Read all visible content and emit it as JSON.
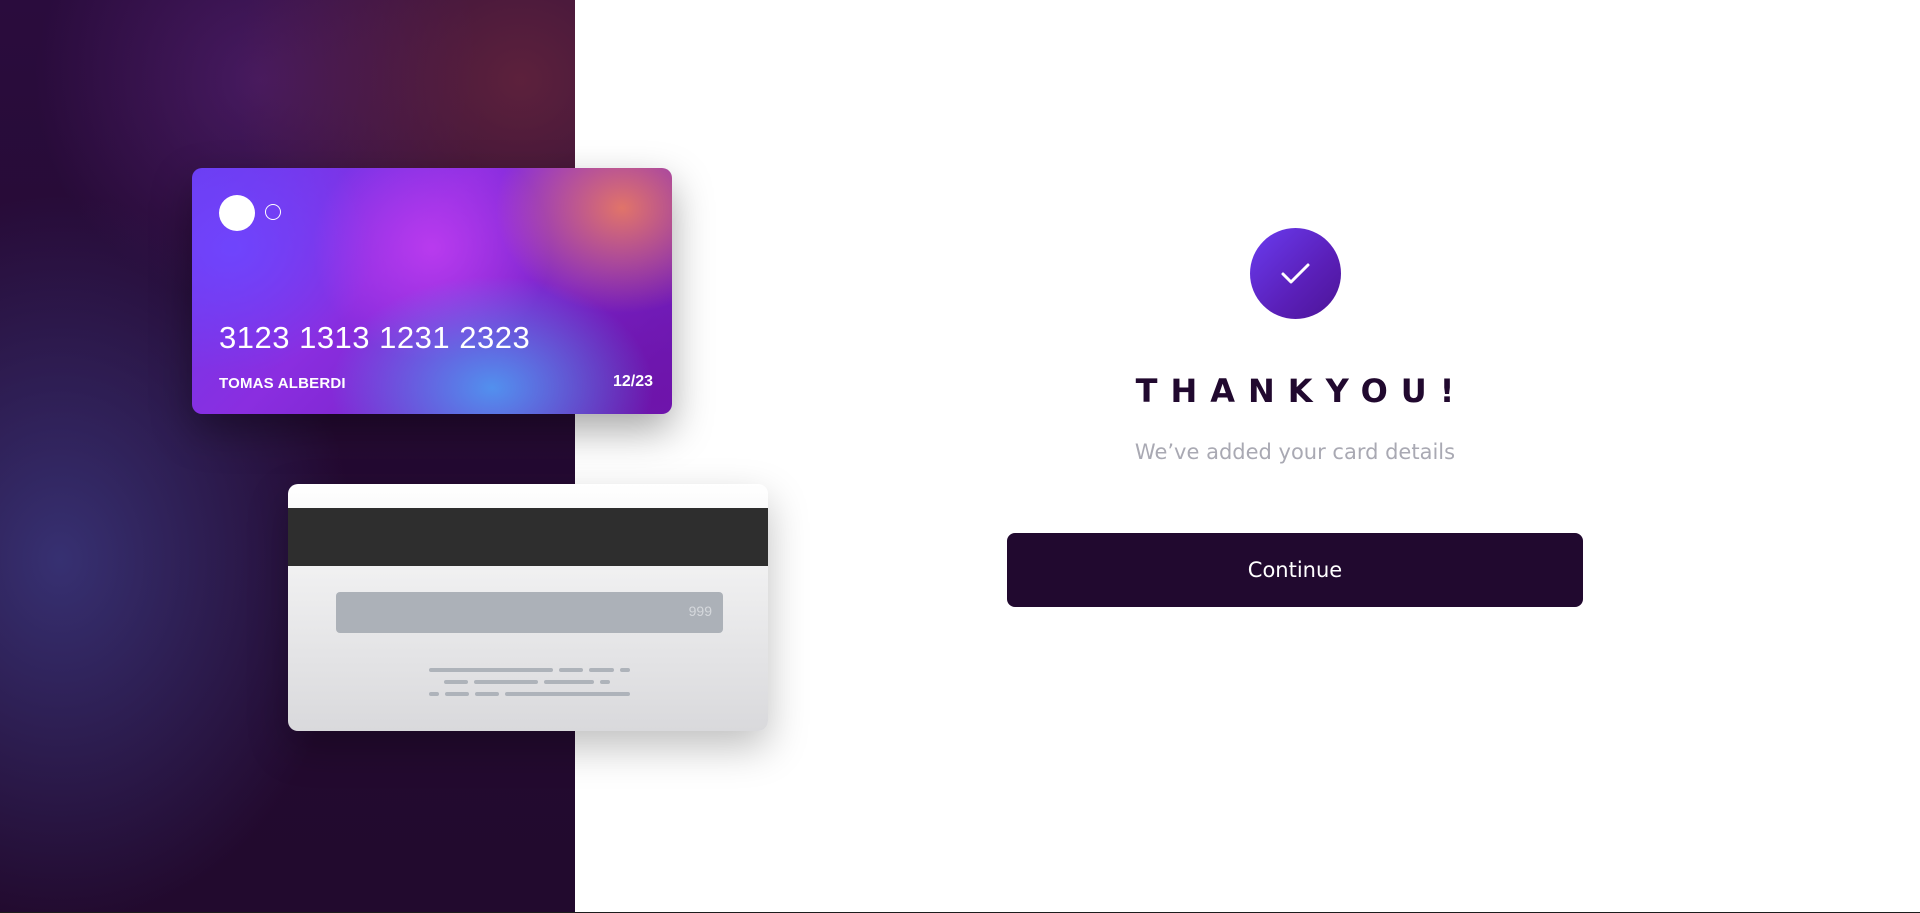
{
  "card_front": {
    "number": "3123 1313 1231 2323",
    "holder": "TOMAS ALBERDI",
    "expiry": "12/23"
  },
  "card_back": {
    "cvv": "999"
  },
  "confirmation": {
    "icon": "checkmark-icon",
    "title": "THANKYOU!",
    "subtitle": "We’ve added your card details",
    "button_label": "Continue"
  },
  "colors": {
    "dark": "#21092f",
    "accent": "#6a3cf0",
    "subtitle": "#a9a9b3"
  }
}
